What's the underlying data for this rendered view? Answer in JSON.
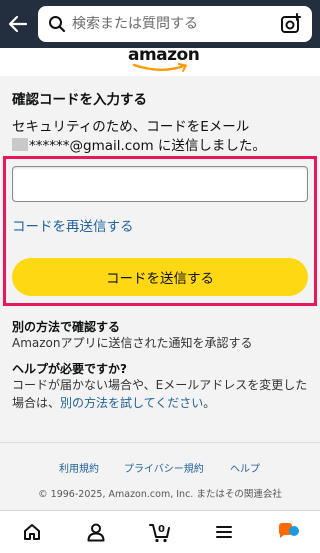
{
  "header": {
    "search_placeholder": "検索または質問する"
  },
  "logo": {
    "text": "amazon"
  },
  "main": {
    "title": "確認コードを入力する",
    "desc_line1": "セキュリティのため、コードをEメール",
    "email_masked": "******@gmail.com",
    "desc_line2_suffix": " に送信しました。",
    "code_input_value": "",
    "resend_link": "コードを再送信する",
    "send_button": "コードを送信する",
    "alt_heading": "別の方法で確認する",
    "alt_desc": "Amazonアプリに送信された通知を承認する",
    "help_heading": "ヘルプが必要ですか?",
    "help_desc": "コードが届かない場合や、Eメールアドレスを変更した場合は、",
    "help_link": "別の方法を試してください",
    "help_end": "。"
  },
  "footer": {
    "links": [
      "利用規約",
      "プライバシー規約",
      "ヘルプ"
    ],
    "copyright": "© 1996-2025, Amazon.com, Inc. またはその関連会社"
  },
  "bottom_nav": {
    "cart_count": "0",
    "icons": [
      "home-icon",
      "account-icon",
      "cart-icon",
      "menu-icon",
      "assistant-icon"
    ]
  },
  "colors": {
    "header_bg": "#232f3e",
    "link": "#2162a1",
    "button_yellow": "#ffd814",
    "highlight_border": "#e8185a",
    "logo_smile": "#ff9900"
  }
}
